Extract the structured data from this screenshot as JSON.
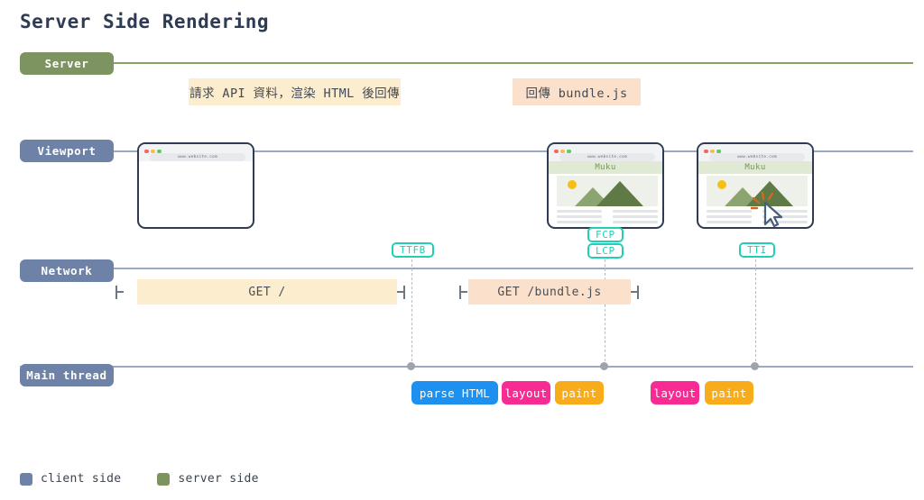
{
  "title": "Server Side Rendering",
  "lanes": [
    {
      "name": "server",
      "label": "Server"
    },
    {
      "name": "viewport",
      "label": "Viewport"
    },
    {
      "name": "network",
      "label": "Network"
    },
    {
      "name": "main_thread",
      "label": "Main thread"
    }
  ],
  "server_messages": [
    {
      "label": "請求 API 資料，渲染 HTML 後回傳"
    },
    {
      "label": "回傳 bundle.js"
    }
  ],
  "browsers": [
    {
      "url": "www.website.com",
      "heading": "",
      "rendered": false,
      "cursor": false
    },
    {
      "url": "www.website.com",
      "heading": "Muku",
      "rendered": true,
      "cursor": false
    },
    {
      "url": "www.website.com",
      "heading": "Muku",
      "rendered": true,
      "cursor": true
    }
  ],
  "markers": [
    {
      "label": "TTFB"
    },
    {
      "label": "FCP"
    },
    {
      "label": "LCP"
    },
    {
      "label": "TTI"
    }
  ],
  "network_requests": [
    {
      "label": "GET /"
    },
    {
      "label": "GET /bundle.js"
    }
  ],
  "main_thread_tasks": [
    {
      "label": "parse HTML",
      "kind": "parse"
    },
    {
      "label": "layout",
      "kind": "layout"
    },
    {
      "label": "paint",
      "kind": "paint"
    },
    {
      "label": "layout",
      "kind": "layout"
    },
    {
      "label": "paint",
      "kind": "paint"
    }
  ],
  "legend": [
    {
      "label": "client side",
      "color": "#6d82a6"
    },
    {
      "label": "server side",
      "color": "#7d9360"
    }
  ],
  "colors": {
    "server_accent": "#7d9360",
    "client_accent": "#6d82a6",
    "marker_accent": "#20cfb4",
    "parse": "#1e90f0",
    "layout": "#f72b93",
    "paint": "#f8ac1c",
    "cream": "#fcedcf",
    "peach": "#fbe0cb"
  }
}
